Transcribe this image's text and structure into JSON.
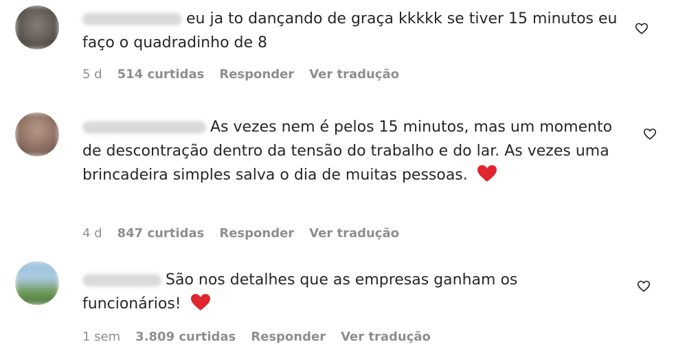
{
  "comments": [
    {
      "text": "eu ja to dançando de graça kkkkk se tiver 15 minutos eu faço o quadradinho de 8",
      "time": "5 d",
      "likes": "514 curtidas",
      "reply": "Responder",
      "translate": "Ver tradução",
      "emoji": ""
    },
    {
      "text": "As vezes nem é pelos 15 minutos, mas um momento de descontração dentro da tensão do trabalho e do lar. As vezes uma brincadeira simples salva o dia de muitas pessoas.",
      "time": "4 d",
      "likes": "847 curtidas",
      "reply": "Responder",
      "translate": "Ver tradução",
      "emoji": "red-heart"
    },
    {
      "text": "São nos detalhes que as empresas ganham os funcionários!",
      "time": "1 sem",
      "likes": "3.809 curtidas",
      "reply": "Responder",
      "translate": "Ver tradução",
      "emoji": "red-heart"
    }
  ],
  "colors": {
    "text": "#262626",
    "meta": "#8e8e8e",
    "heart_emoji": "#e0262e"
  },
  "icons": {
    "like": "heart-outline-icon",
    "emoji": "red-heart-emoji"
  }
}
